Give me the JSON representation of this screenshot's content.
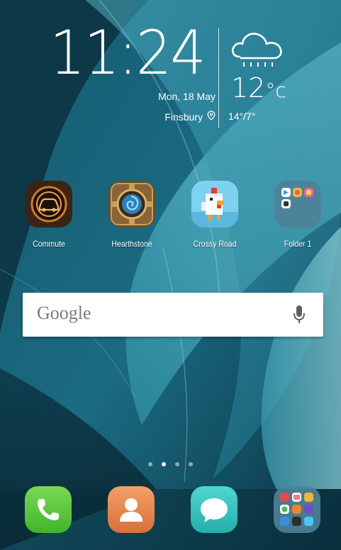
{
  "clock": {
    "time": "11:24",
    "date": "Mon, 18 May",
    "location": "Finsbury"
  },
  "weather": {
    "temperature": "12",
    "unit": "°c",
    "range": "14°/7°",
    "icon": "rain-cloud-icon"
  },
  "apps": [
    {
      "label": "Commute",
      "icon": "commute-car-icon"
    },
    {
      "label": "Hearthstone",
      "icon": "hearthstone-icon"
    },
    {
      "label": "Crossy Road",
      "icon": "crossy-road-chicken-icon"
    },
    {
      "label": "Folder 1",
      "icon": "folder-icon"
    }
  ],
  "search": {
    "logo": "Google",
    "mic_icon": "microphone-icon"
  },
  "pager": {
    "page_count": 4,
    "active_page": 2
  },
  "dock": [
    {
      "icon": "phone-icon",
      "color": "#5cc93c"
    },
    {
      "icon": "contacts-icon",
      "color": "#e8884a"
    },
    {
      "icon": "messages-icon",
      "color": "#39c5c1"
    },
    {
      "icon": "dock-folder-icon",
      "color": "#3d6f87"
    }
  ],
  "colors": {
    "wallpaper_dark": "#0e3b4d",
    "wallpaper_light": "#3fa0b8"
  }
}
